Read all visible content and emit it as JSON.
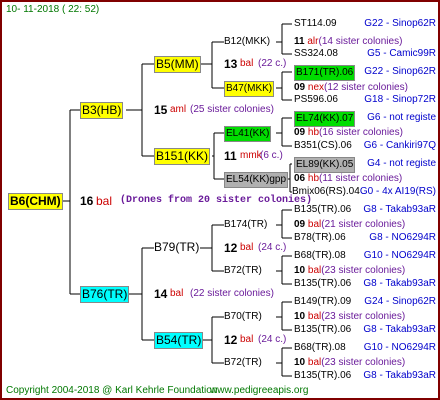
{
  "header": {
    "date": "10- 11-2018 ( 22: 52)"
  },
  "footer": {
    "copyright": "Copyright 2004-2018 @ Karl Kehrle Foundation",
    "site": "www.pedigreeapis.org"
  },
  "root": {
    "name": "B6(CHM)",
    "num": "16",
    "code": "bal",
    "note": "(Drones from 20 sister colonies)"
  },
  "g1": [
    {
      "name": "B3(HB)",
      "num": "15",
      "code": "aml",
      "note": "(25 sister colonies)"
    },
    {
      "name": "B76(TR)",
      "num": "14",
      "code": "bal",
      "note": "(22 sister colonies)"
    }
  ],
  "g2": [
    {
      "name": "B5(MM)",
      "num": "13",
      "code": "bal",
      "note": "(22 c.)"
    },
    {
      "name": "B151(KK)",
      "num": "11",
      "code": "mmk",
      "note": "(6 c.)"
    },
    {
      "name": "B79(TR)",
      "num": "12",
      "code": "bal",
      "note": "(24 c.)"
    },
    {
      "name": "B54(TR)",
      "num": "12",
      "code": "bal",
      "note": "(24 c.)"
    }
  ],
  "g3": [
    {
      "name": "B12(MKK)",
      "num": "11",
      "code": "alr",
      "note": "(14 sister colonies)"
    },
    {
      "name": "B47(MKK)",
      "num": "09",
      "code": "nex",
      "note": "(12 sister colonies)"
    },
    {
      "name": "EL41(KK)",
      "num": "09",
      "code": "hb",
      "note": "(16 sister colonies)"
    },
    {
      "name": "EL54(KK)gpp",
      "num": "06",
      "code": "hb",
      "note": "(11 sister colonies)"
    },
    {
      "name": "B174(TR)",
      "num": "09",
      "code": "bal",
      "note": "(21 sister colonies)"
    },
    {
      "name": "B72(TR)",
      "num": "10",
      "code": "bal",
      "note": "(23 sister colonies)"
    },
    {
      "name": "B70(TR)",
      "num": "10",
      "code": "bal",
      "note": "(23 sister colonies)"
    },
    {
      "name": "B72(TR)",
      "num": "10",
      "code": "bal",
      "note": "(23 sister colonies)"
    }
  ],
  "g4": [
    {
      "name": "ST114.09",
      "info": "G22 - Sinop62R"
    },
    {
      "name": "SS324.08",
      "info": "G5 - Camic99R"
    },
    {
      "name": "B171(TR).06",
      "info": "G22 - Sinop62R"
    },
    {
      "name": "PS596.06",
      "info": "G18 - Sinop72R"
    },
    {
      "name": "EL74(KK).07",
      "info": "G6 - not registe"
    },
    {
      "name": "B351(CS).06",
      "info": "G6 - Cankiri97Q"
    },
    {
      "name": "EL89(KK).05",
      "info": "G4 - not registe"
    },
    {
      "name": "Bmix06(RS).04",
      "info": "G0 - 4x AI19(RS)"
    },
    {
      "name": "B135(TR).06",
      "info": "G8 - Takab93aR"
    },
    {
      "name": "B78(TR).06",
      "info": "G8 - NO6294R"
    },
    {
      "name": "B68(TR).08",
      "info": "G10 - NO6294R"
    },
    {
      "name": "B135(TR).06",
      "info": "G8 - Takab93aR"
    },
    {
      "name": "B149(TR).09",
      "info": "G24 - Sinop62R"
    },
    {
      "name": "B135(TR).06",
      "info": "G8 - Takab93aR"
    },
    {
      "name": "B68(TR).08",
      "info": "G10 - NO6294R"
    },
    {
      "name": "B135(TR).06",
      "info": "G8 - Takab93aR"
    }
  ]
}
